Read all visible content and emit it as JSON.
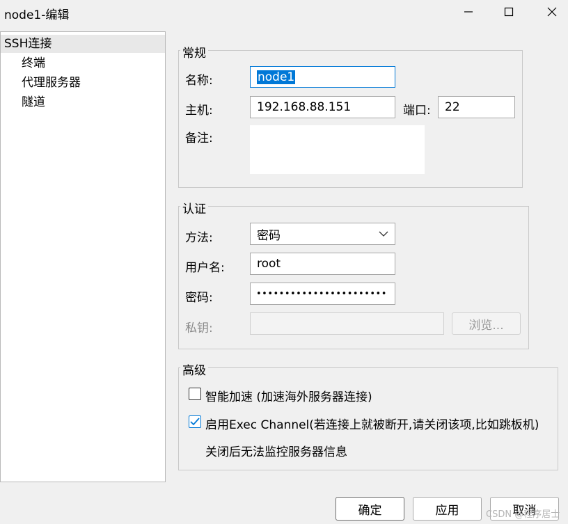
{
  "window": {
    "title": "node1-编辑"
  },
  "tree": {
    "items": [
      {
        "label": "SSH连接"
      },
      {
        "label": "终端"
      },
      {
        "label": "代理服务器"
      },
      {
        "label": "隧道"
      }
    ]
  },
  "general": {
    "title": "常规",
    "name_label": "名称:",
    "name_value": "node1",
    "host_label": "主机:",
    "host_value": "192.168.88.151",
    "port_label": "端口:",
    "port_value": "22",
    "note_label": "备注:",
    "note_value": ""
  },
  "auth": {
    "title": "认证",
    "method_label": "方法:",
    "method_value": "密码",
    "user_label": "用户名:",
    "user_value": "root",
    "password_label": "密码:",
    "password_value": "•••••••••••••••••••••••",
    "key_label": "私钥:",
    "key_value": "",
    "browse_label": "浏览..."
  },
  "advanced": {
    "title": "高级",
    "accel_label": "智能加速 (加速海外服务器连接)",
    "accel_checked": false,
    "exec_label": "启用Exec Channel(若连接上就被断开,请关闭该项,比如跳板机)",
    "exec_checked": true,
    "exec_note": "关闭后无法监控服务器信息"
  },
  "footer": {
    "ok_label": "确定",
    "apply_label": "应用",
    "cancel_label": "取消"
  },
  "watermark": "CSDN @程序居士"
}
